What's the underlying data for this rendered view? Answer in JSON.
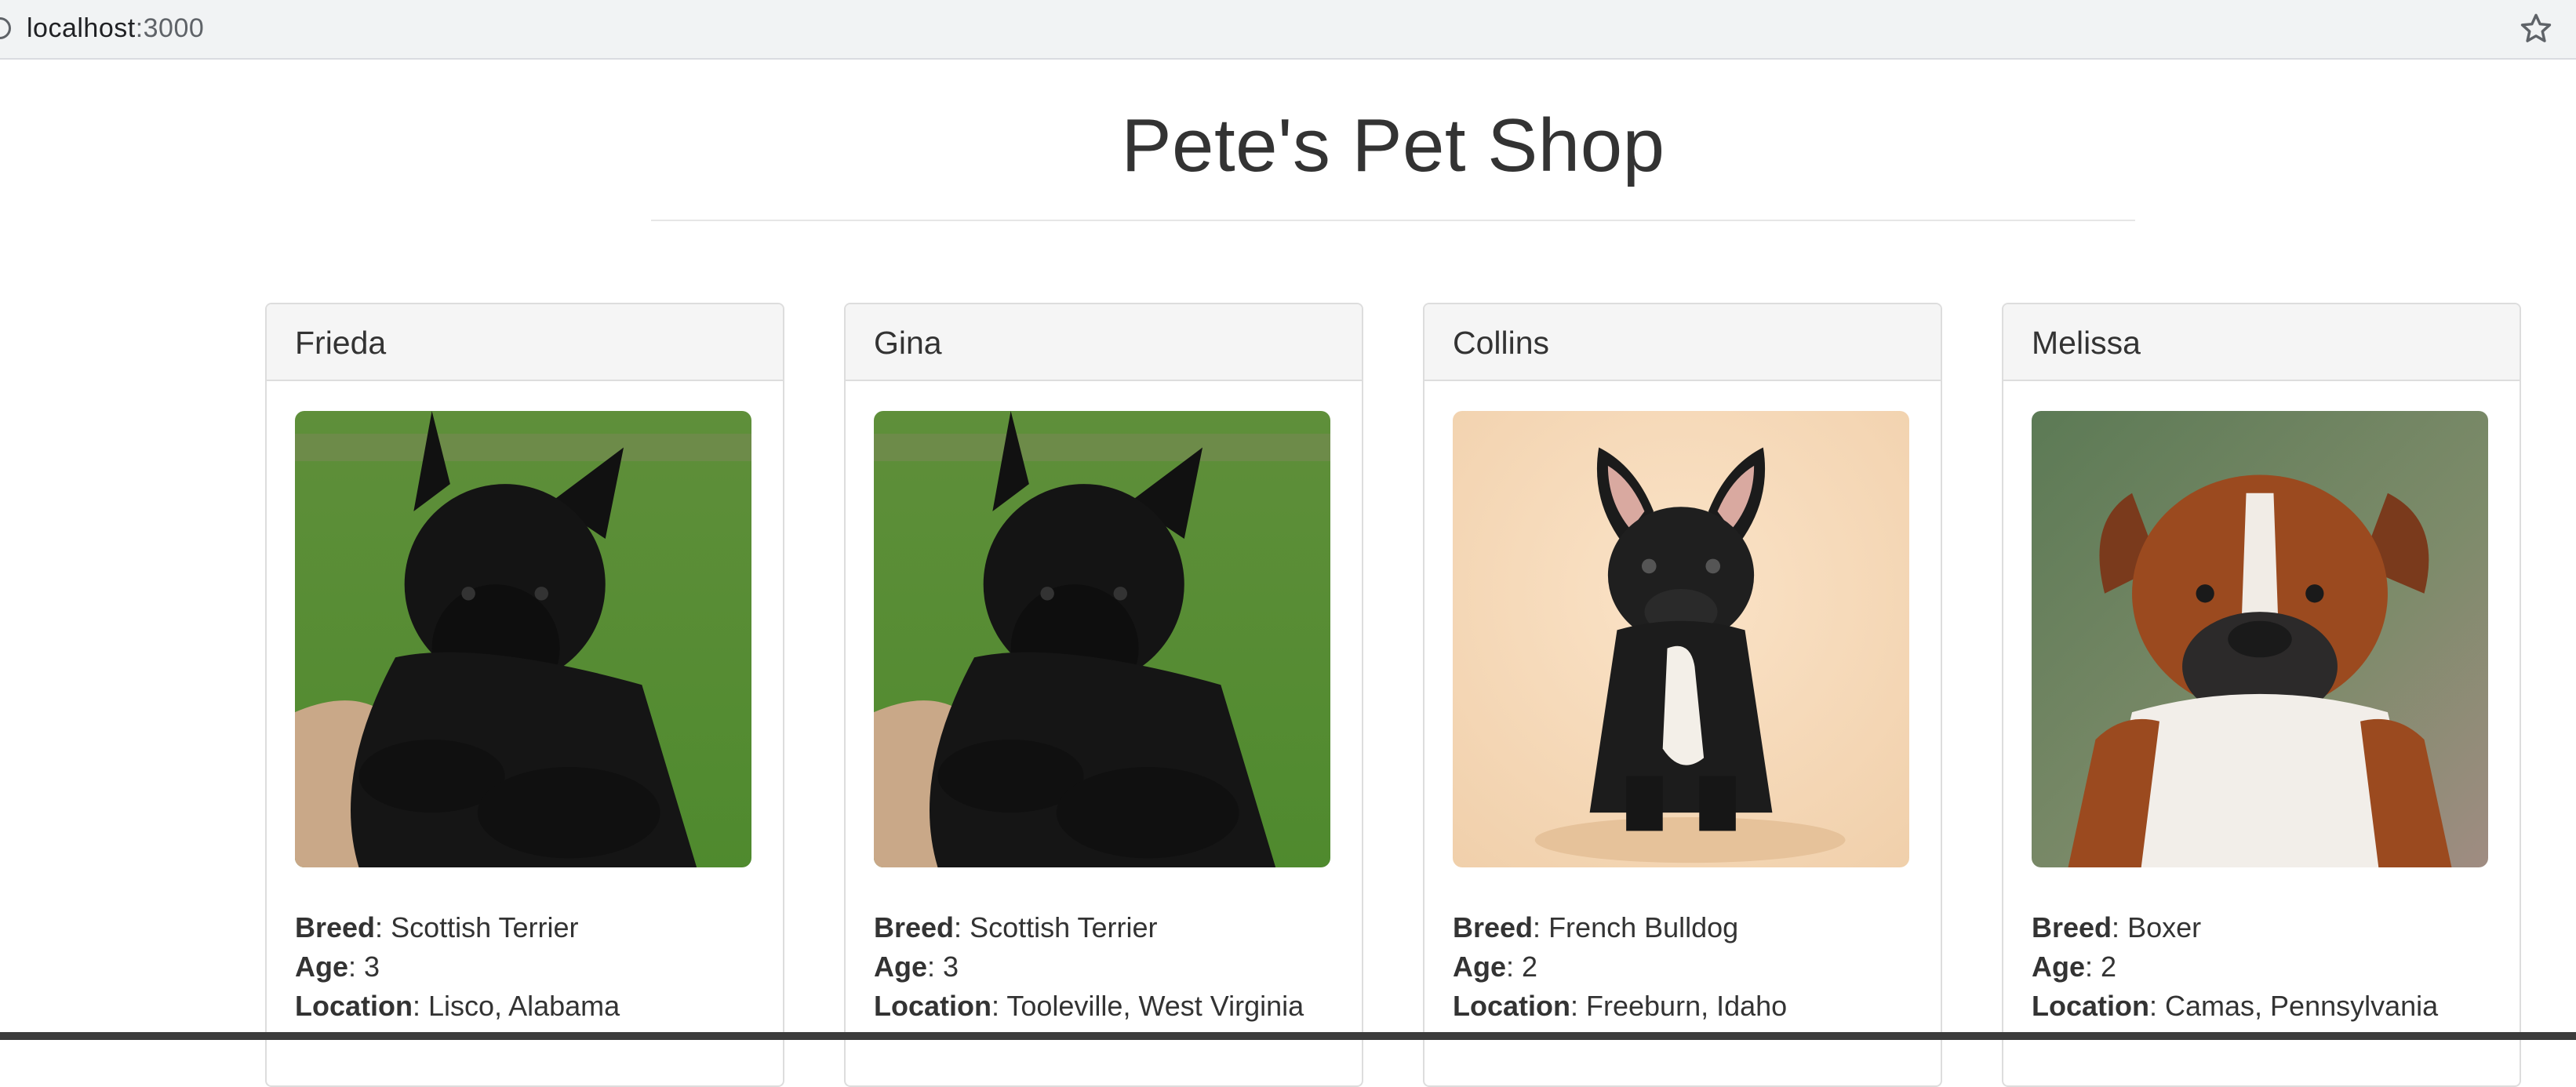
{
  "browser": {
    "url_host": "localhost",
    "url_port": ":3000",
    "info_icon": "info-icon",
    "bookmark_icon": "star-icon"
  },
  "page": {
    "title": "Pete's Pet Shop"
  },
  "labels": {
    "breed": "Breed",
    "age": "Age",
    "location": "Location"
  },
  "pets": [
    {
      "name": "Frieda",
      "breed": "Scottish Terrier",
      "age": "3",
      "location": "Lisco, Alabama",
      "photo": "scottish-terrier-photo"
    },
    {
      "name": "Gina",
      "breed": "Scottish Terrier",
      "age": "3",
      "location": "Tooleville, West Virginia",
      "photo": "scottish-terrier-photo"
    },
    {
      "name": "Collins",
      "breed": "French Bulldog",
      "age": "2",
      "location": "Freeburn, Idaho",
      "photo": "french-bulldog-photo"
    },
    {
      "name": "Melissa",
      "breed": "Boxer",
      "age": "2",
      "location": "Camas, Pennsylvania",
      "photo": "boxer-photo"
    }
  ]
}
